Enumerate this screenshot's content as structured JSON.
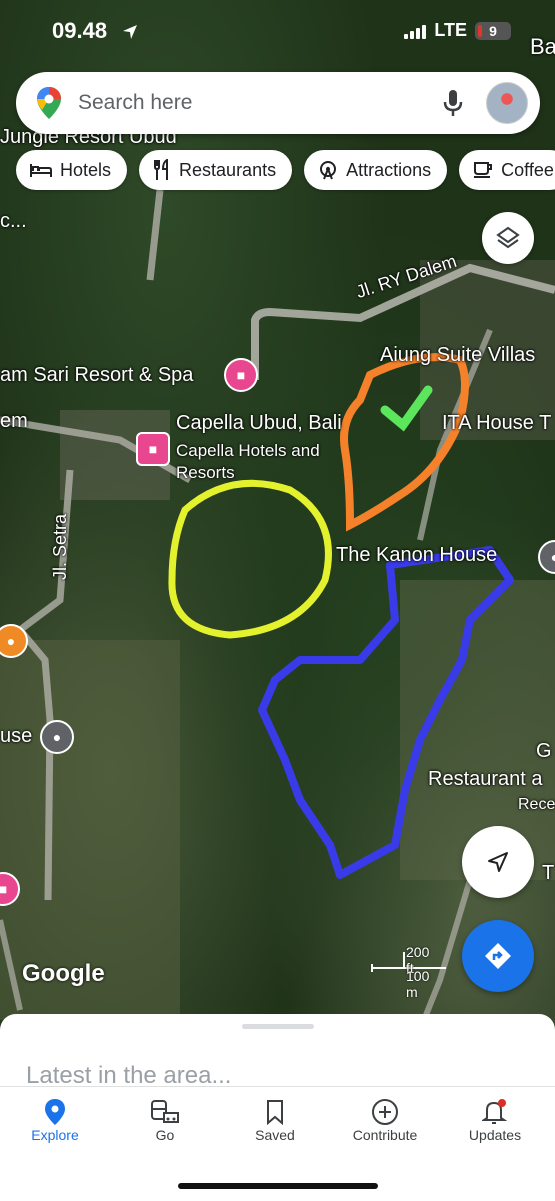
{
  "status_bar": {
    "time": "09.48",
    "network": "LTE",
    "battery": "9"
  },
  "search": {
    "placeholder": "Search here"
  },
  "chips": [
    {
      "label": "Hotels",
      "icon": "bed-icon"
    },
    {
      "label": "Restaurants",
      "icon": "fork-knife-icon"
    },
    {
      "label": "Attractions",
      "icon": "ferris-wheel-icon"
    },
    {
      "label": "Coffee",
      "icon": "coffee-cup-icon"
    }
  ],
  "map": {
    "labels": {
      "jungle_resort": "Jungle Resort Ubud",
      "jl_ry_dalem": "Jl. RY Dalem",
      "aiung_suite": "Aiung Suite Villas",
      "alam_sari": "am Sari Resort & Spa",
      "capella": "Capella Ubud, Bali",
      "capella_sub": "Capella Hotels and Resorts",
      "ita_house": "ITA House T",
      "em": "em",
      "c": "c...",
      "ba": "Ba",
      "jl_setra": "Jl. Setra",
      "kanon_house": "The Kanon House",
      "use": "use",
      "g": "G",
      "restaurant": "Restaurant a",
      "rece": "Rece",
      "t": "T"
    },
    "attribution": "Google",
    "scale": {
      "ft": "200 ft",
      "m": "100 m"
    },
    "annotation_colors": {
      "yellow": "#e4f22e",
      "orange": "#f5822a",
      "blue": "#3a3be8",
      "check": "#5ce65c"
    }
  },
  "sheet": {
    "title": "Latest in the area..."
  },
  "nav": [
    {
      "label": "Explore",
      "active": true
    },
    {
      "label": "Go",
      "active": false
    },
    {
      "label": "Saved",
      "active": false
    },
    {
      "label": "Contribute",
      "active": false
    },
    {
      "label": "Updates",
      "active": false
    }
  ],
  "colors": {
    "accent": "#1a73e8",
    "hotel_pin": "#e8468f",
    "restaurant_pin": "#f08a24"
  }
}
